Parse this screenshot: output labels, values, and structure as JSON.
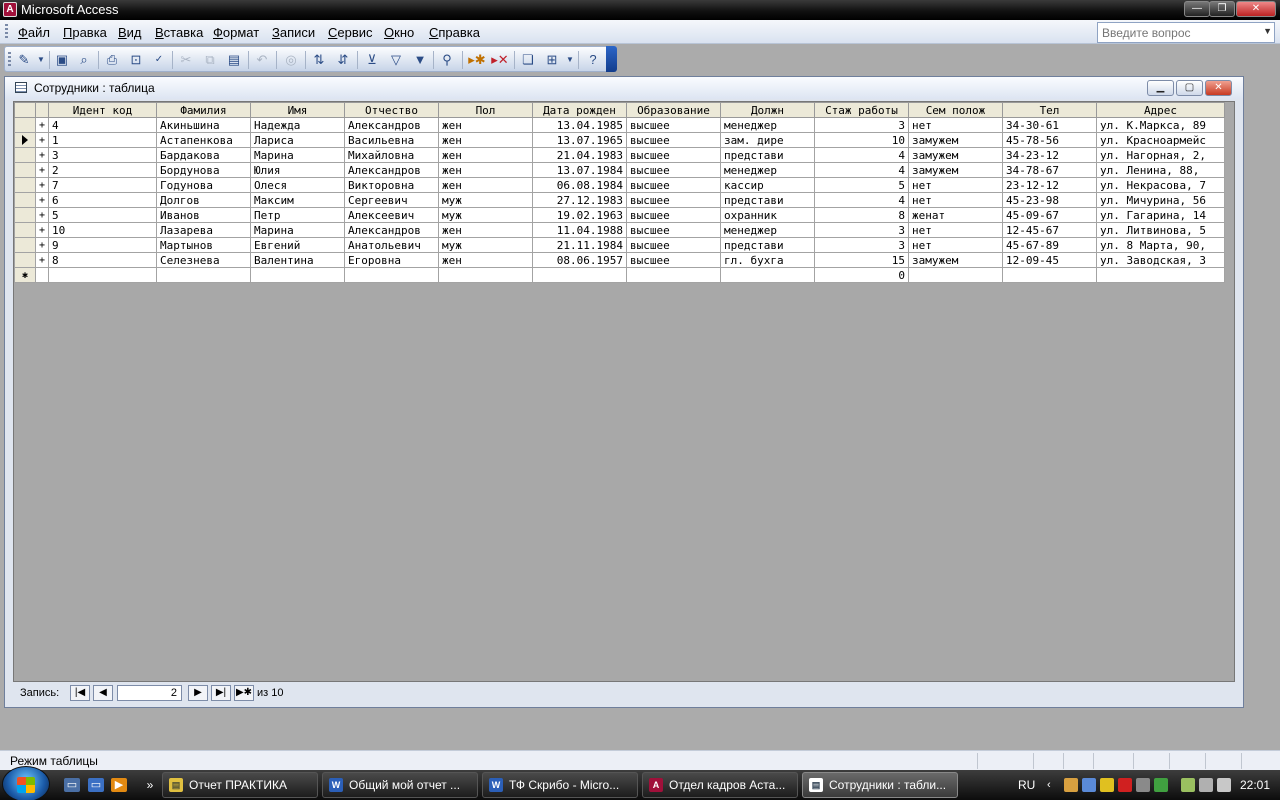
{
  "app": {
    "title": "Microsoft Access"
  },
  "menu": {
    "items": [
      "Файл",
      "Правка",
      "Вид",
      "Вставка",
      "Формат",
      "Записи",
      "Сервис",
      "Окно",
      "Справка"
    ],
    "help_placeholder": "Введите вопрос"
  },
  "toolbar": {
    "icons": [
      "view-icon",
      "save-icon",
      "file-search-icon",
      "print-icon",
      "print-preview-icon",
      "spelling-icon",
      "cut-icon",
      "copy-icon",
      "paste-icon",
      "undo-icon",
      "hyperlink-icon",
      "sort-ascending-icon",
      "sort-descending-icon",
      "filter-by-selection-icon",
      "filter-by-form-icon",
      "apply-filter-icon",
      "find-icon",
      "new-record-icon",
      "delete-record-icon",
      "database-window-icon",
      "new-object-icon",
      "help-icon"
    ]
  },
  "child_window": {
    "title": "Сотрудники : таблица"
  },
  "table": {
    "columns": [
      "Идент код",
      "Фамилия",
      "Имя",
      "Отчество",
      "Пол",
      "Дата рожден",
      "Образование",
      "Должн",
      "Стаж работы",
      "Сем полож",
      "Тел",
      "Адрес"
    ],
    "rows": [
      [
        "4",
        "Акиньшина",
        "Надежда",
        "Александров",
        "жен",
        "13.04.1985",
        "высшее",
        "менеджер",
        "3",
        "нет",
        "34-30-61",
        "ул. К.Маркса, 89"
      ],
      [
        "1",
        "Астапенкова",
        "Лариса",
        "Васильевна",
        "жен",
        "13.07.1965",
        "высшее",
        "зам. дире",
        "10",
        "замужем",
        "45-78-56",
        "ул. Красноармейс"
      ],
      [
        "3",
        "Бардакова",
        "Марина",
        "Михайловна",
        "жен",
        "21.04.1983",
        "высшее",
        "представи",
        "4",
        "замужем",
        "34-23-12",
        "ул. Нагорная, 2,"
      ],
      [
        "2",
        "Бордунова",
        "Юлия",
        "Александров",
        "жен",
        "13.07.1984",
        "высшее",
        "менеджер",
        "4",
        "замужем",
        "34-78-67",
        "ул. Ленина, 88,"
      ],
      [
        "7",
        "Годунова",
        "Олеся",
        "Викторовна",
        "жен",
        "06.08.1984",
        "высшее",
        "кассир",
        "5",
        "нет",
        "23-12-12",
        "ул. Некрасова, 7"
      ],
      [
        "6",
        "Долгов",
        "Максим",
        "Сергеевич",
        "муж",
        "27.12.1983",
        "высшее",
        "представи",
        "4",
        "нет",
        "45-23-98",
        "ул. Мичурина, 56"
      ],
      [
        "5",
        "Иванов",
        "Петр",
        "Алексеевич",
        "муж",
        "19.02.1963",
        "высшее",
        "охранник",
        "8",
        "женат",
        "45-09-67",
        "ул. Гагарина, 14"
      ],
      [
        "10",
        "Лазарева",
        "Марина",
        "Александров",
        "жен",
        "11.04.1988",
        "высшее",
        "менеджер",
        "3",
        "нет",
        "12-45-67",
        "ул. Литвинова, 5"
      ],
      [
        "9",
        "Мартынов",
        "Евгений",
        "Анатольевич",
        "муж",
        "21.11.1984",
        "высшее",
        "представи",
        "3",
        "нет",
        "45-67-89",
        "ул. 8 Марта, 90,"
      ],
      [
        "8",
        "Селезнева",
        "Валентина",
        "Егоровна",
        "жен",
        "08.06.1957",
        "высшее",
        "гл. бухга",
        "15",
        "замужем",
        "12-09-45",
        "ул. Заводская, 3"
      ]
    ],
    "new_row_default_experience": "0",
    "current_row_index": 1
  },
  "navigator": {
    "label": "Запись:",
    "current": "2",
    "of_text": "из 10"
  },
  "status": {
    "text": "Режим таблицы"
  },
  "taskbar": {
    "tasks": [
      "Отчет ПРАКТИКА",
      "Общий мой отчет ...",
      "ТФ Скрибо - Micro...",
      "Отдел кадров Аста...",
      "Сотрудники : табли..."
    ],
    "language": "RU",
    "clock": "22:01"
  }
}
